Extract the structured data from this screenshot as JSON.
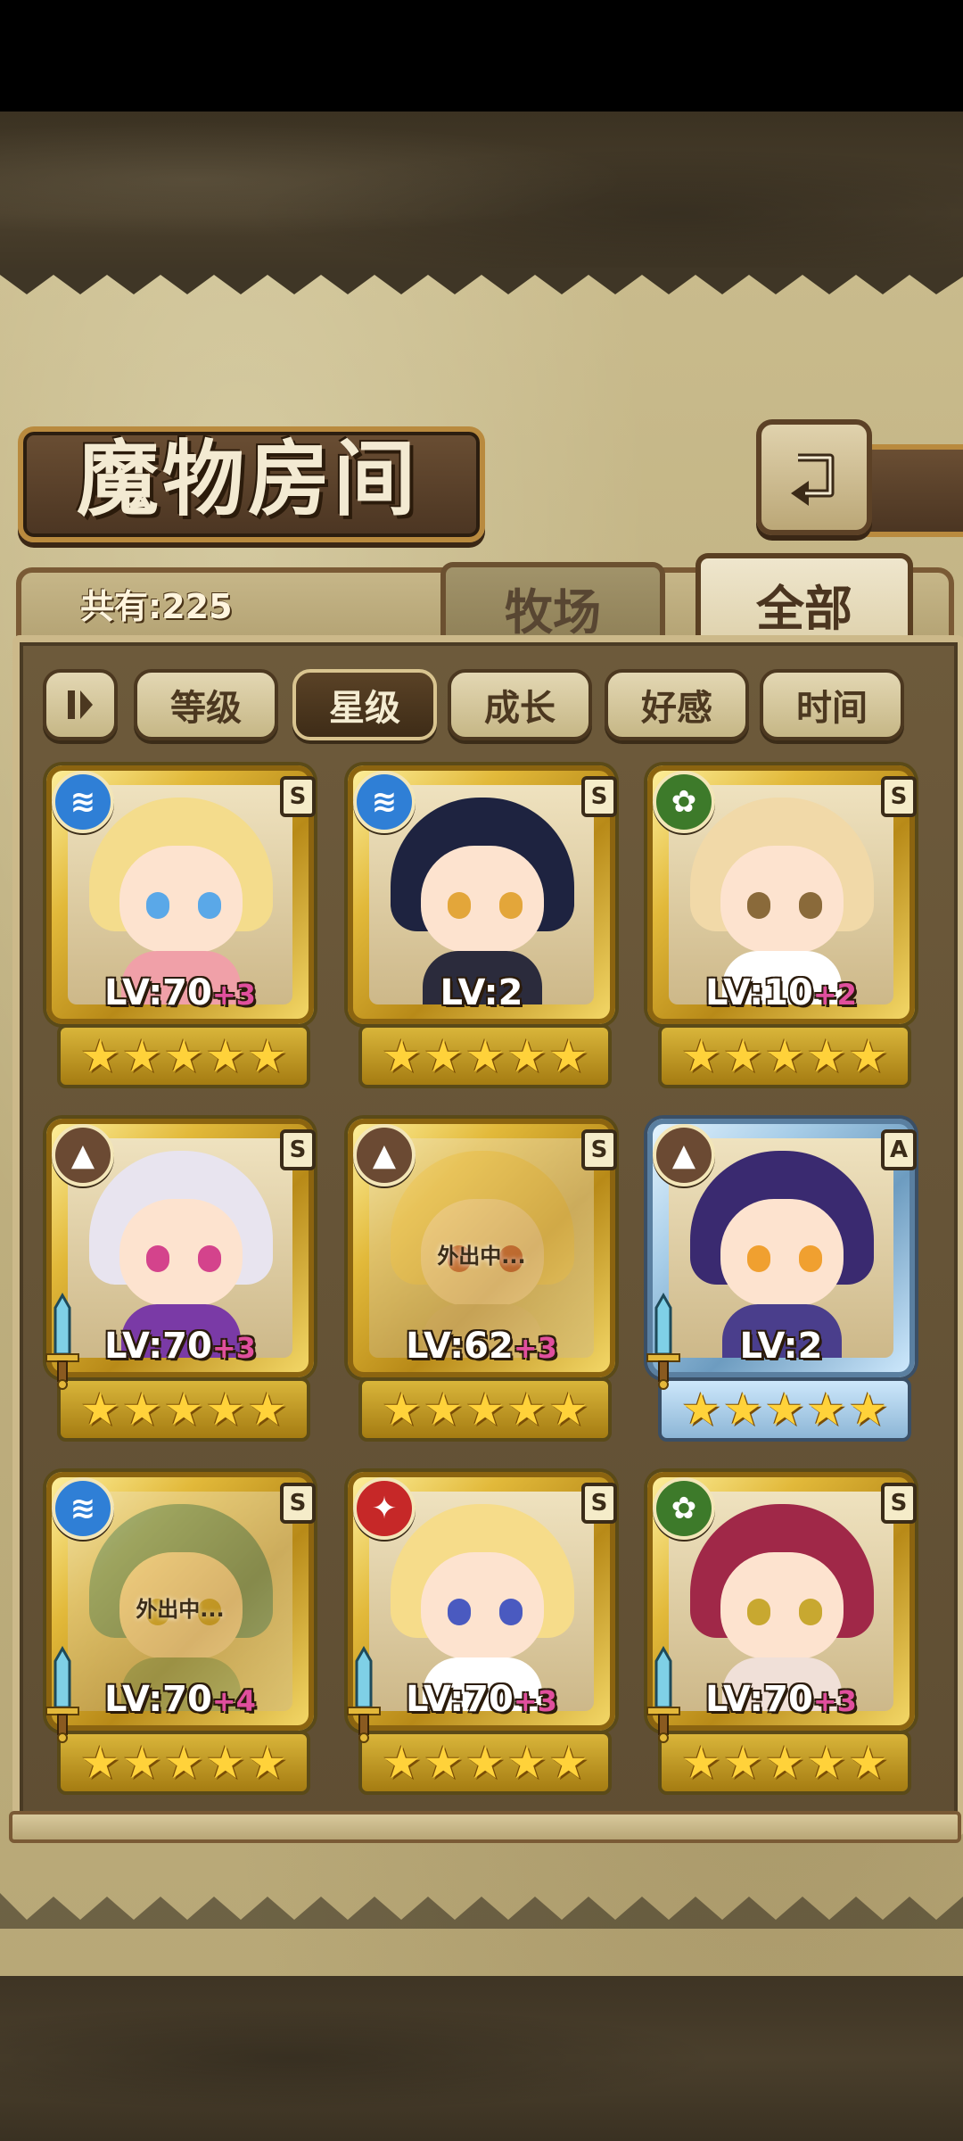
{
  "title": "魔物房间",
  "total_count": "共有:225",
  "tabs": {
    "farm": "牧场",
    "all": "全部"
  },
  "active_tab": "全部",
  "filters": [
    {
      "label": "等级",
      "active": false
    },
    {
      "label": "星级",
      "active": true
    },
    {
      "label": "成长",
      "active": false
    },
    {
      "label": "好感",
      "active": false
    },
    {
      "label": "时间",
      "active": false
    }
  ],
  "cards": [
    {
      "element": "water",
      "element_color": "#2f7fd6",
      "rank": "S",
      "level": "LV:70",
      "plus": "+3",
      "stars": 5,
      "weapon": false,
      "away": false,
      "away_text": "",
      "frame": "gold",
      "hair": "#f4dc8c",
      "eyes": "#5aa8e8",
      "outfit": "#f0a0a8"
    },
    {
      "element": "water",
      "element_color": "#2f7fd6",
      "rank": "S",
      "level": "LV:2",
      "plus": "",
      "stars": 5,
      "weapon": false,
      "away": false,
      "away_text": "",
      "frame": "gold",
      "hair": "#1e2340",
      "eyes": "#e3a63a",
      "outfit": "#2b2b3c"
    },
    {
      "element": "wood",
      "element_color": "#3d7a2a",
      "rank": "S",
      "level": "LV:10",
      "plus": "+2",
      "stars": 5,
      "weapon": false,
      "away": false,
      "away_text": "",
      "frame": "gold",
      "hair": "#f1d9a8",
      "eyes": "#8a6a3a",
      "outfit": "#ffffff"
    },
    {
      "element": "earth",
      "element_color": "#6b4a33",
      "rank": "S",
      "level": "LV:70",
      "plus": "+3",
      "stars": 5,
      "weapon": true,
      "away": false,
      "away_text": "",
      "frame": "gold",
      "hair": "#e8e4ef",
      "eyes": "#d4438c",
      "outfit": "#7a3aa6"
    },
    {
      "element": "earth",
      "element_color": "#6b4a33",
      "rank": "S",
      "level": "LV:62",
      "plus": "+3",
      "stars": 5,
      "weapon": false,
      "away": true,
      "away_text": "外出中...",
      "frame": "gold",
      "hair": "#f0d080",
      "eyes": "#c0404a",
      "outfit": "#d8c0a0"
    },
    {
      "element": "earth",
      "element_color": "#6b4a33",
      "rank": "A",
      "level": "LV:2",
      "plus": "",
      "stars": 5,
      "weapon": true,
      "away": false,
      "away_text": "",
      "frame": "blue",
      "hair": "#3a2a70",
      "eyes": "#f0a030",
      "outfit": "#4a3e8c"
    },
    {
      "element": "water",
      "element_color": "#2f7fd6",
      "rank": "S",
      "level": "LV:70",
      "plus": "+4",
      "stars": 5,
      "weapon": true,
      "away": true,
      "away_text": "外出中...",
      "frame": "gold",
      "hair": "#4a8a8a",
      "eyes": "#c8a030",
      "outfit": "#7a9a7a"
    },
    {
      "element": "fire",
      "element_color": "#c62828",
      "rank": "S",
      "level": "LV:70",
      "plus": "+3",
      "stars": 5,
      "weapon": true,
      "away": false,
      "away_text": "",
      "frame": "gold",
      "hair": "#f6dc8a",
      "eyes": "#4a5ac0",
      "outfit": "#ffffff"
    },
    {
      "element": "wood",
      "element_color": "#3d7a2a",
      "rank": "S",
      "level": "LV:70",
      "plus": "+3",
      "stars": 5,
      "weapon": true,
      "away": false,
      "away_text": "",
      "frame": "gold",
      "hair": "#a02848",
      "eyes": "#c8a830",
      "outfit": "#f0e0d8"
    }
  ]
}
